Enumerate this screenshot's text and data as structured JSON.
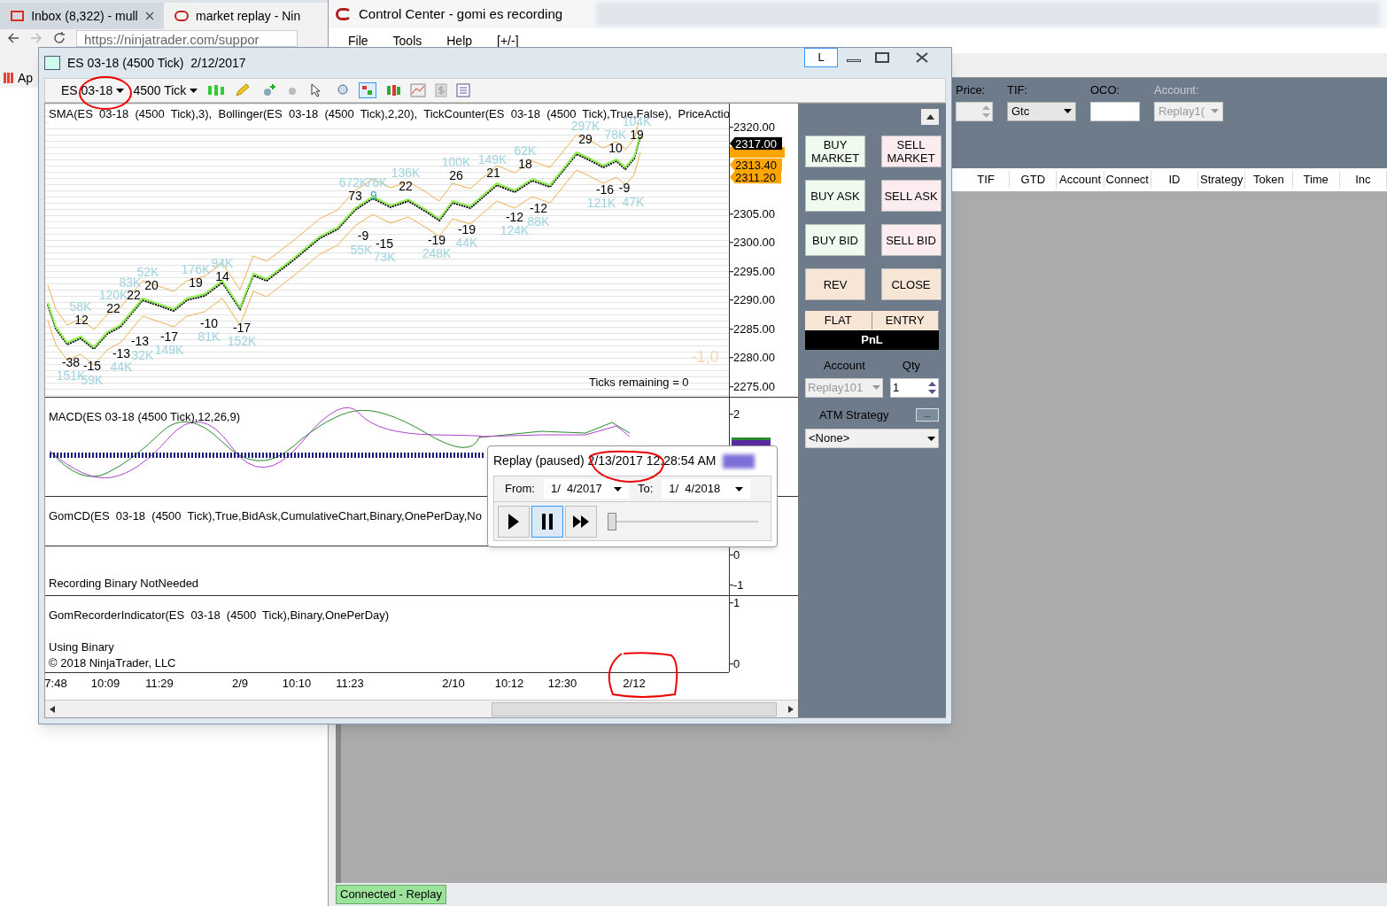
{
  "browser": {
    "tabs": [
      {
        "title": "Inbox (8,322) - mull",
        "selected": false
      },
      {
        "title": "market replay - Nin",
        "selected": true
      }
    ],
    "address": "https://ninjatrader.com/suppor",
    "bookmark": "Ap"
  },
  "control_center": {
    "title": "Control Center - gomi es recording",
    "menu": [
      "File",
      "Tools",
      "Help",
      "[+/-]"
    ],
    "order_entry": [
      {
        "label": "Price:",
        "kind": "spinner"
      },
      {
        "label": "TIF:",
        "kind": "select",
        "value": "Gtc",
        "disabled": false
      },
      {
        "label": "OCO:",
        "kind": "text"
      },
      {
        "label": "Account:",
        "kind": "select",
        "value": "Replay1(",
        "disabled": true
      }
    ],
    "orders_columns": [
      "TIF",
      "GTD",
      "Account",
      "Connect",
      "ID",
      "Strategy",
      "Token",
      "Time",
      "Inc"
    ],
    "status_bar": "Connected - Replay"
  },
  "chart_window": {
    "title": "ES 03-18 (4500 Tick)  2/12/2017",
    "link_button": "L",
    "toolbar": {
      "instrument": "ES 03-18",
      "interval": "4500 Tick"
    },
    "price_panel": {
      "indicators": "SMA(ES  03-18  (4500  Tick),3),  Bollinger(ES  03-18  (4500  Tick),2,20),  TickCounter(ES  03-18  (4500  Tick),True,False),  PriceActio",
      "ticks": [
        "2320.00",
        "2305.00",
        "2300.00",
        "2295.00",
        "2290.00",
        "2285.00",
        "2280.00",
        "2275.00"
      ],
      "markers": [
        {
          "text": "2317.00",
          "color": "#000000"
        },
        {
          "text": "2313.40",
          "color": "#ffa500"
        },
        {
          "text": "2311.20",
          "color": "#ffa500"
        }
      ],
      "swing_labels": [
        {
          "text": "-38",
          "kind": "count"
        },
        {
          "text": "151K",
          "kind": "volume"
        },
        {
          "text": "-15",
          "kind": "count"
        },
        {
          "text": "59K",
          "kind": "volume"
        },
        {
          "text": "58K",
          "kind": "volume"
        },
        {
          "text": "12",
          "kind": "count"
        },
        {
          "text": "120K",
          "kind": "volume"
        },
        {
          "text": "22",
          "kind": "count"
        },
        {
          "text": "83K",
          "kind": "volume"
        },
        {
          "text": "22",
          "kind": "count"
        },
        {
          "text": "52K",
          "kind": "volume"
        },
        {
          "text": "20",
          "kind": "count"
        },
        {
          "text": "-13",
          "kind": "count"
        },
        {
          "text": "-13",
          "kind": "count"
        },
        {
          "text": "44K",
          "kind": "volume"
        },
        {
          "text": "32K",
          "kind": "volume"
        },
        {
          "text": "-17",
          "kind": "count"
        },
        {
          "text": "149K",
          "kind": "volume"
        },
        {
          "text": "176K",
          "kind": "volume"
        },
        {
          "text": "19",
          "kind": "count"
        },
        {
          "text": "94K",
          "kind": "volume"
        },
        {
          "text": "14",
          "kind": "count"
        },
        {
          "text": "-10",
          "kind": "count"
        },
        {
          "text": "81K",
          "kind": "volume"
        },
        {
          "text": "-17",
          "kind": "count"
        },
        {
          "text": "152K",
          "kind": "volume"
        },
        {
          "text": "672K",
          "kind": "volume"
        },
        {
          "text": "76K",
          "kind": "volume"
        },
        {
          "text": "73",
          "kind": "count"
        },
        {
          "text": "9",
          "kind": "highlight"
        },
        {
          "text": "-9",
          "kind": "count"
        },
        {
          "text": "55K",
          "kind": "volume"
        },
        {
          "text": "-15",
          "kind": "count"
        },
        {
          "text": "73K",
          "kind": "volume"
        },
        {
          "text": "136K",
          "kind": "volume"
        },
        {
          "text": "22",
          "kind": "count"
        },
        {
          "text": "100K",
          "kind": "volume"
        },
        {
          "text": "26",
          "kind": "count"
        },
        {
          "text": "149K",
          "kind": "volume"
        },
        {
          "text": "21",
          "kind": "count"
        },
        {
          "text": "62K",
          "kind": "volume"
        },
        {
          "text": "18",
          "kind": "count"
        },
        {
          "text": "-19",
          "kind": "count"
        },
        {
          "text": "248K",
          "kind": "volume"
        },
        {
          "text": "-19",
          "kind": "count"
        },
        {
          "text": "44K",
          "kind": "volume"
        },
        {
          "text": "-12",
          "kind": "count"
        },
        {
          "text": "124K",
          "kind": "volume"
        },
        {
          "text": "-12",
          "kind": "count"
        },
        {
          "text": "88K",
          "kind": "volume"
        },
        {
          "text": "297K",
          "kind": "volume"
        },
        {
          "text": "29",
          "kind": "count"
        },
        {
          "text": "78K",
          "kind": "volume"
        },
        {
          "text": "10",
          "kind": "count"
        },
        {
          "text": "104K",
          "kind": "volume"
        },
        {
          "text": "19",
          "kind": "count"
        },
        {
          "text": "-16",
          "kind": "count"
        },
        {
          "text": "121K",
          "kind": "volume"
        },
        {
          "text": "-9",
          "kind": "count"
        },
        {
          "text": "47K",
          "kind": "volume"
        },
        {
          "text": "-1,0",
          "kind": "faint"
        }
      ],
      "ticks_remaining": "Ticks remaining = 0"
    },
    "macd_panel": {
      "label": "MACD(ES 03-18 (4500 Tick),12,26,9)",
      "ticks": [
        "2"
      ]
    },
    "gomcd_panel": {
      "label": "GomCD(ES  03-18  (4500  Tick),True,BidAsk,CumulativeChart,Binary,OnePerDay,No",
      "status": "Recording Binary NotNeeded",
      "ticks": [
        "0",
        "-1"
      ]
    },
    "recorder_panel": {
      "label": "GomRecorderIndicator(ES  03-18  (4500  Tick),Binary,OnePerDay)",
      "status": "Using Binary",
      "copyright": "© 2018 NinjaTrader, LLC",
      "ticks": [
        "1",
        "0"
      ]
    },
    "time_axis": [
      "7:48",
      "10:09",
      "11:29",
      "2/9",
      "10:10",
      "11:23",
      "2/10",
      "10:12",
      "12:30",
      "2/12"
    ],
    "chart_trader": {
      "buttons": [
        {
          "label": "BUY MARKET",
          "kind": "buy"
        },
        {
          "label": "SELL MARKET",
          "kind": "sell"
        },
        {
          "label": "BUY ASK",
          "kind": "buy"
        },
        {
          "label": "SELL ASK",
          "kind": "sell"
        },
        {
          "label": "BUY BID",
          "kind": "buy"
        },
        {
          "label": "SELL BID",
          "kind": "sell"
        },
        {
          "label": "REV",
          "kind": "neutral"
        },
        {
          "label": "CLOSE",
          "kind": "neutral"
        }
      ],
      "position": [
        "FLAT",
        "ENTRY"
      ],
      "pnl": "PnL",
      "account_label": "Account",
      "qty_label": "Qty",
      "account": {
        "value": "Replay101",
        "disabled": true
      },
      "qty": "1",
      "atm_label": "ATM Strategy",
      "atm_button": "...",
      "atm_value": "<None>"
    }
  },
  "replay": {
    "status": "Replay (paused) 2/13/2017 12:28:54 AM",
    "from_label": "From:",
    "from": "1/  4/2017",
    "to_label": "To:",
    "to": "1/  4/2018",
    "controls": [
      {
        "kind": "play",
        "selected": false
      },
      {
        "kind": "pause",
        "selected": true
      },
      {
        "kind": "fast_forward",
        "selected": false
      }
    ],
    "level": 0
  }
}
